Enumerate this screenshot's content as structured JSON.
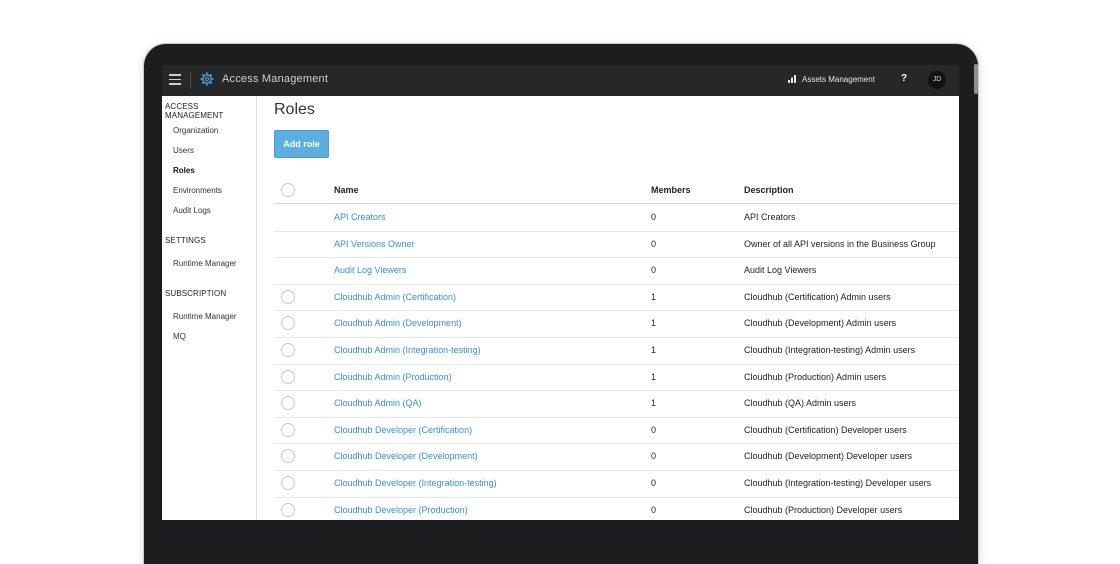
{
  "topbar": {
    "app_title": "Access Management",
    "assets_label": "Assets Management",
    "help_label": "?",
    "avatar_initials": "JD"
  },
  "sidebar": {
    "sections": [
      {
        "title": "ACCESS MANAGEMENT",
        "items": [
          "Organization",
          "Users",
          "Roles",
          "Environments",
          "Audit Logs"
        ]
      },
      {
        "title": "SETTINGS",
        "items": [
          "Runtime Manager"
        ]
      },
      {
        "title": "SUBSCRIPTION",
        "items": [
          "Runtime Manager",
          "MQ"
        ]
      }
    ],
    "active_item": "Roles"
  },
  "main": {
    "title": "Roles",
    "add_button": "Add role",
    "columns": {
      "name": "Name",
      "members": "Members",
      "description": "Description"
    },
    "rows": [
      {
        "name": "API Creators",
        "members": "0",
        "description": "API Creators",
        "selectable": false
      },
      {
        "name": "API Versions Owner",
        "members": "0",
        "description": "Owner of all API versions in the Business Group",
        "selectable": false
      },
      {
        "name": "Audit Log Viewers",
        "members": "0",
        "description": "Audit Log Viewers",
        "selectable": false
      },
      {
        "name": "Cloudhub Admin (Certification)",
        "members": "1",
        "description": "Cloudhub (Certification) Admin users",
        "selectable": true
      },
      {
        "name": "Cloudhub Admin (Development)",
        "members": "1",
        "description": "Cloudhub (Development) Admin users",
        "selectable": true
      },
      {
        "name": "Cloudhub Admin (Integration-testing)",
        "members": "1",
        "description": "Cloudhub (Integration-testing) Admin users",
        "selectable": true
      },
      {
        "name": "Cloudhub Admin (Production)",
        "members": "1",
        "description": "Cloudhub (Production) Admin users",
        "selectable": true
      },
      {
        "name": "Cloudhub Admin (QA)",
        "members": "1",
        "description": "Cloudhub (QA) Admin users",
        "selectable": true
      },
      {
        "name": "Cloudhub Developer (Certification)",
        "members": "0",
        "description": "Cloudhub (Certification) Developer users",
        "selectable": true
      },
      {
        "name": "Cloudhub Developer (Development)",
        "members": "0",
        "description": "Cloudhub (Development) Developer users",
        "selectable": true
      },
      {
        "name": "Cloudhub Developer (Integration-testing)",
        "members": "0",
        "description": "Cloudhub (Integration-testing) Developer users",
        "selectable": true
      },
      {
        "name": "Cloudhub Developer (Production)",
        "members": "0",
        "description": "Cloudhub (Production) Developer users",
        "selectable": true
      }
    ]
  },
  "colors": {
    "topbar_bg": "#262729",
    "link": "#3b8fcf",
    "button": "#5aaee0",
    "gear_icon": "#4aa3df"
  },
  "icons": [
    "hamburger-menu-icon",
    "gear-icon",
    "assets-icon",
    "help-icon"
  ]
}
